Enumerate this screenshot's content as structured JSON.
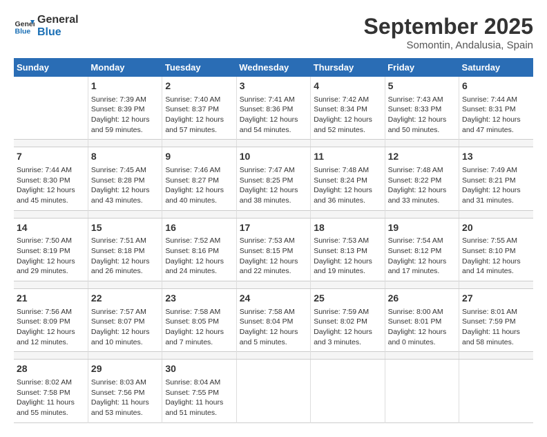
{
  "logo": {
    "line1": "General",
    "line2": "Blue"
  },
  "title": "September 2025",
  "subtitle": "Somontin, Andalusia, Spain",
  "days_header": [
    "Sunday",
    "Monday",
    "Tuesday",
    "Wednesday",
    "Thursday",
    "Friday",
    "Saturday"
  ],
  "weeks": [
    [
      {
        "num": "",
        "info": ""
      },
      {
        "num": "1",
        "info": "Sunrise: 7:39 AM\nSunset: 8:39 PM\nDaylight: 12 hours\nand 59 minutes."
      },
      {
        "num": "2",
        "info": "Sunrise: 7:40 AM\nSunset: 8:37 PM\nDaylight: 12 hours\nand 57 minutes."
      },
      {
        "num": "3",
        "info": "Sunrise: 7:41 AM\nSunset: 8:36 PM\nDaylight: 12 hours\nand 54 minutes."
      },
      {
        "num": "4",
        "info": "Sunrise: 7:42 AM\nSunset: 8:34 PM\nDaylight: 12 hours\nand 52 minutes."
      },
      {
        "num": "5",
        "info": "Sunrise: 7:43 AM\nSunset: 8:33 PM\nDaylight: 12 hours\nand 50 minutes."
      },
      {
        "num": "6",
        "info": "Sunrise: 7:44 AM\nSunset: 8:31 PM\nDaylight: 12 hours\nand 47 minutes."
      }
    ],
    [
      {
        "num": "7",
        "info": "Sunrise: 7:44 AM\nSunset: 8:30 PM\nDaylight: 12 hours\nand 45 minutes."
      },
      {
        "num": "8",
        "info": "Sunrise: 7:45 AM\nSunset: 8:28 PM\nDaylight: 12 hours\nand 43 minutes."
      },
      {
        "num": "9",
        "info": "Sunrise: 7:46 AM\nSunset: 8:27 PM\nDaylight: 12 hours\nand 40 minutes."
      },
      {
        "num": "10",
        "info": "Sunrise: 7:47 AM\nSunset: 8:25 PM\nDaylight: 12 hours\nand 38 minutes."
      },
      {
        "num": "11",
        "info": "Sunrise: 7:48 AM\nSunset: 8:24 PM\nDaylight: 12 hours\nand 36 minutes."
      },
      {
        "num": "12",
        "info": "Sunrise: 7:48 AM\nSunset: 8:22 PM\nDaylight: 12 hours\nand 33 minutes."
      },
      {
        "num": "13",
        "info": "Sunrise: 7:49 AM\nSunset: 8:21 PM\nDaylight: 12 hours\nand 31 minutes."
      }
    ],
    [
      {
        "num": "14",
        "info": "Sunrise: 7:50 AM\nSunset: 8:19 PM\nDaylight: 12 hours\nand 29 minutes."
      },
      {
        "num": "15",
        "info": "Sunrise: 7:51 AM\nSunset: 8:18 PM\nDaylight: 12 hours\nand 26 minutes."
      },
      {
        "num": "16",
        "info": "Sunrise: 7:52 AM\nSunset: 8:16 PM\nDaylight: 12 hours\nand 24 minutes."
      },
      {
        "num": "17",
        "info": "Sunrise: 7:53 AM\nSunset: 8:15 PM\nDaylight: 12 hours\nand 22 minutes."
      },
      {
        "num": "18",
        "info": "Sunrise: 7:53 AM\nSunset: 8:13 PM\nDaylight: 12 hours\nand 19 minutes."
      },
      {
        "num": "19",
        "info": "Sunrise: 7:54 AM\nSunset: 8:12 PM\nDaylight: 12 hours\nand 17 minutes."
      },
      {
        "num": "20",
        "info": "Sunrise: 7:55 AM\nSunset: 8:10 PM\nDaylight: 12 hours\nand 14 minutes."
      }
    ],
    [
      {
        "num": "21",
        "info": "Sunrise: 7:56 AM\nSunset: 8:09 PM\nDaylight: 12 hours\nand 12 minutes."
      },
      {
        "num": "22",
        "info": "Sunrise: 7:57 AM\nSunset: 8:07 PM\nDaylight: 12 hours\nand 10 minutes."
      },
      {
        "num": "23",
        "info": "Sunrise: 7:58 AM\nSunset: 8:05 PM\nDaylight: 12 hours\nand 7 minutes."
      },
      {
        "num": "24",
        "info": "Sunrise: 7:58 AM\nSunset: 8:04 PM\nDaylight: 12 hours\nand 5 minutes."
      },
      {
        "num": "25",
        "info": "Sunrise: 7:59 AM\nSunset: 8:02 PM\nDaylight: 12 hours\nand 3 minutes."
      },
      {
        "num": "26",
        "info": "Sunrise: 8:00 AM\nSunset: 8:01 PM\nDaylight: 12 hours\nand 0 minutes."
      },
      {
        "num": "27",
        "info": "Sunrise: 8:01 AM\nSunset: 7:59 PM\nDaylight: 11 hours\nand 58 minutes."
      }
    ],
    [
      {
        "num": "28",
        "info": "Sunrise: 8:02 AM\nSunset: 7:58 PM\nDaylight: 11 hours\nand 55 minutes."
      },
      {
        "num": "29",
        "info": "Sunrise: 8:03 AM\nSunset: 7:56 PM\nDaylight: 11 hours\nand 53 minutes."
      },
      {
        "num": "30",
        "info": "Sunrise: 8:04 AM\nSunset: 7:55 PM\nDaylight: 11 hours\nand 51 minutes."
      },
      {
        "num": "",
        "info": ""
      },
      {
        "num": "",
        "info": ""
      },
      {
        "num": "",
        "info": ""
      },
      {
        "num": "",
        "info": ""
      }
    ]
  ]
}
